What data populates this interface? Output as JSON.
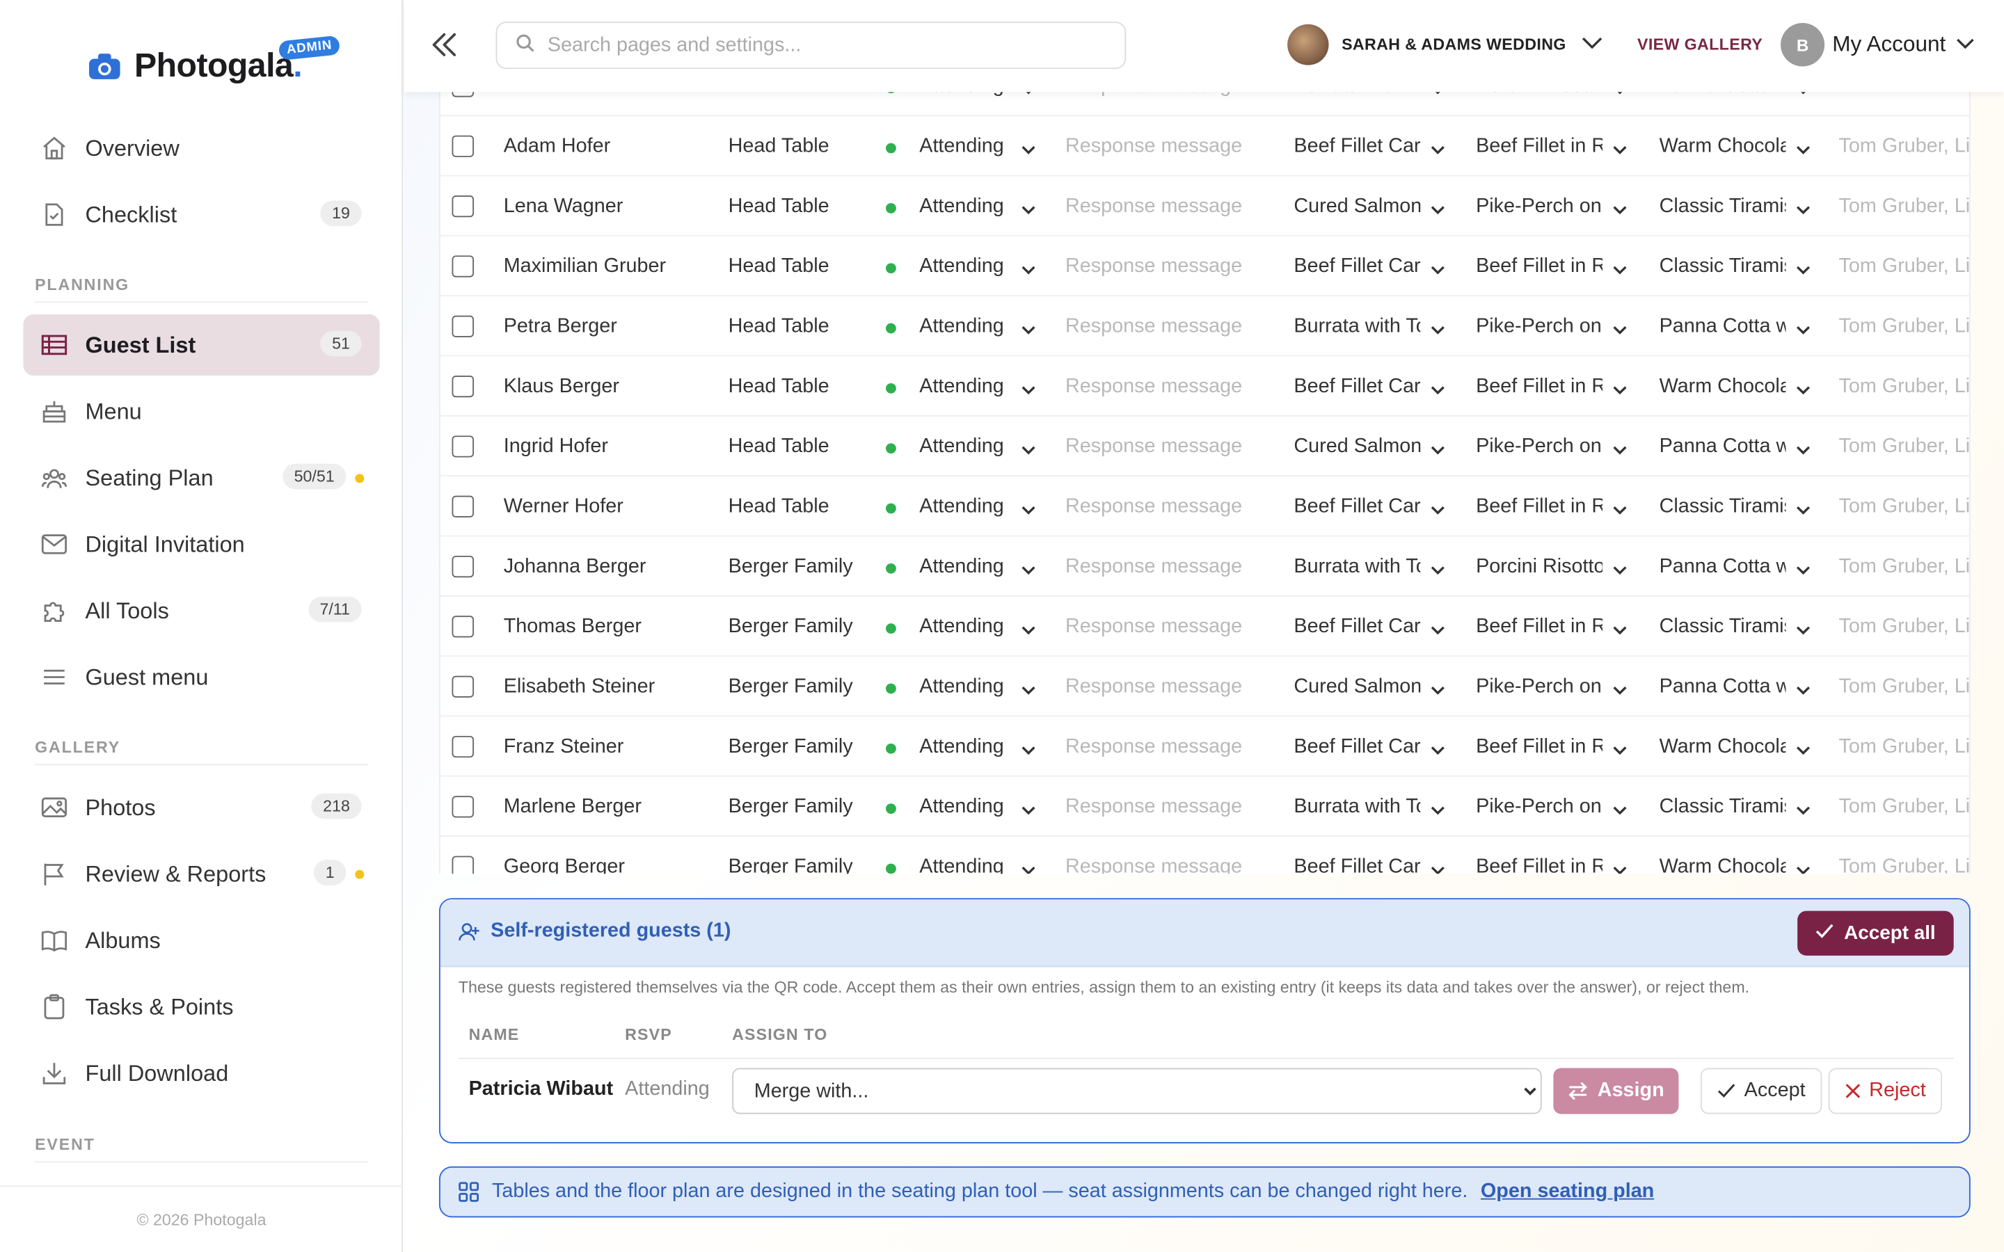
{
  "app": {
    "name_main": "Photogala",
    "name_dot": ".",
    "admin_badge": "ADMIN"
  },
  "sidebar": {
    "items": [
      {
        "label": "Overview",
        "icon": "home-icon"
      },
      {
        "label": "Checklist",
        "icon": "checklist-icon",
        "badge": "19"
      },
      {
        "label": "Guest List",
        "icon": "table-icon",
        "badge": "51",
        "active": true
      },
      {
        "label": "Menu",
        "icon": "cake-icon"
      },
      {
        "label": "Seating Plan",
        "icon": "people-icon",
        "badge": "50/51",
        "dot": true
      },
      {
        "label": "Digital Invitation",
        "icon": "envelope-icon"
      },
      {
        "label": "All Tools",
        "icon": "puzzle-icon",
        "badge": "7/11"
      },
      {
        "label": "Guest menu",
        "icon": "hamburger-icon"
      },
      {
        "label": "Photos",
        "icon": "image-icon",
        "badge": "218"
      },
      {
        "label": "Review & Reports",
        "icon": "flag-icon",
        "badge": "1",
        "dot": true
      },
      {
        "label": "Albums",
        "icon": "book-icon"
      },
      {
        "label": "Tasks & Points",
        "icon": "clipboard-icon"
      },
      {
        "label": "Full Download",
        "icon": "download-icon"
      }
    ],
    "sections": {
      "planning": "PLANNING",
      "gallery": "GALLERY",
      "event": "EVENT"
    },
    "footer": "© 2026 Photogala"
  },
  "header": {
    "search_placeholder": "Search pages and settings...",
    "event_name": "SARAH & ADAMS WEDDING",
    "view_gallery": "VIEW GALLERY",
    "account_initial": "B",
    "account_label": "My Account"
  },
  "guests": {
    "partial_row": {
      "rsvp": "Attending",
      "message": "Response message",
      "m1": "Burrata with T",
      "m2": "Porcini Risott",
      "m3": "Panna Cotta w"
    },
    "rows": [
      {
        "name": "Adam Hofer",
        "table": "Head Table",
        "rsvp": "Attending",
        "message": "Response message",
        "m1": "Beef Fillet Carpaccio",
        "m2": "Beef Fillet in Red Wine",
        "m3": "Warm Chocolate",
        "tags": "Tom Gruber, Lisa"
      },
      {
        "name": "Lena Wagner",
        "table": "Head Table",
        "rsvp": "Attending",
        "message": "Response message",
        "m1": "Cured Salmon",
        "m2": "Pike-Perch on",
        "m3": "Classic Tiramisu",
        "tags": "Tom Gruber, Lisa"
      },
      {
        "name": "Maximilian Gruber",
        "table": "Head Table",
        "rsvp": "Attending",
        "message": "Response message",
        "m1": "Beef Fillet Carpaccio",
        "m2": "Beef Fillet in Red Wine",
        "m3": "Classic Tiramisu",
        "tags": "Tom Gruber, Lisa"
      },
      {
        "name": "Petra Berger",
        "table": "Head Table",
        "rsvp": "Attending",
        "message": "Response message",
        "m1": "Burrata with Tomatoes",
        "m2": "Pike-Perch on",
        "m3": "Panna Cotta with",
        "tags": "Tom Gruber, Lisa"
      },
      {
        "name": "Klaus Berger",
        "table": "Head Table",
        "rsvp": "Attending",
        "message": "Response message",
        "m1": "Beef Fillet Carpaccio",
        "m2": "Beef Fillet in Red Wine",
        "m3": "Warm Chocolate",
        "tags": "Tom Gruber, Lisa"
      },
      {
        "name": "Ingrid Hofer",
        "table": "Head Table",
        "rsvp": "Attending",
        "message": "Response message",
        "m1": "Cured Salmon",
        "m2": "Pike-Perch on",
        "m3": "Panna Cotta with",
        "tags": "Tom Gruber, Lisa"
      },
      {
        "name": "Werner Hofer",
        "table": "Head Table",
        "rsvp": "Attending",
        "message": "Response message",
        "m1": "Beef Fillet Carpaccio",
        "m2": "Beef Fillet in Red Wine",
        "m3": "Classic Tiramisu",
        "tags": "Tom Gruber, Lisa"
      },
      {
        "name": "Johanna Berger",
        "table": "Berger Family",
        "rsvp": "Attending",
        "message": "Response message",
        "m1": "Burrata with Tomatoes",
        "m2": "Porcini Risotto",
        "m3": "Panna Cotta with",
        "tags": "Tom Gruber, Lisa"
      },
      {
        "name": "Thomas Berger",
        "table": "Berger Family",
        "rsvp": "Attending",
        "message": "Response message",
        "m1": "Beef Fillet Carpaccio",
        "m2": "Beef Fillet in Red Wine",
        "m3": "Classic Tiramisu",
        "tags": "Tom Gruber, Lisa"
      },
      {
        "name": "Elisabeth Steiner",
        "table": "Berger Family",
        "rsvp": "Attending",
        "message": "Response message",
        "m1": "Cured Salmon",
        "m2": "Pike-Perch on",
        "m3": "Panna Cotta with",
        "tags": "Tom Gruber, Lisa"
      },
      {
        "name": "Franz Steiner",
        "table": "Berger Family",
        "rsvp": "Attending",
        "message": "Response message",
        "m1": "Beef Fillet Carpaccio",
        "m2": "Beef Fillet in Red Wine",
        "m3": "Warm Chocolate",
        "tags": "Tom Gruber, Lisa"
      },
      {
        "name": "Marlene Berger",
        "table": "Berger Family",
        "rsvp": "Attending",
        "message": "Response message",
        "m1": "Burrata with Tomatoes",
        "m2": "Pike-Perch on",
        "m3": "Classic Tiramisu",
        "tags": "Tom Gruber, Lisa"
      },
      {
        "name": "Georg Berger",
        "table": "Berger Family",
        "rsvp": "Attending",
        "message": "Response message",
        "m1": "Beef Fillet Carpaccio",
        "m2": "Beef Fillet in Red Wine",
        "m3": "Warm Chocolate",
        "tags": "Tom Gruber, Lisa"
      }
    ]
  },
  "self_registered": {
    "title": "Self-registered guests (1)",
    "accept_all": "Accept all",
    "description": "These guests registered themselves via the QR code. Accept them as their own entries, assign them to an existing entry (it keeps its data and takes over the answer), or reject them.",
    "col_name": "NAME",
    "col_rsvp": "RSVP",
    "col_assign": "ASSIGN TO",
    "guest": {
      "name": "Patricia Wibaut",
      "rsvp": "Attending"
    },
    "merge_placeholder": "Merge with...",
    "assign": "Assign",
    "accept": "Accept",
    "reject": "Reject"
  },
  "info": {
    "text": "Tables and the floor plan are designed in the seating plan tool — seat assignments can be changed right here.",
    "link": "Open seating plan"
  },
  "colors": {
    "accent": "#7a2246",
    "active_bg": "#e9dde2",
    "info_blue": "#2f68d6",
    "attending_green": "#2fb04f",
    "badge_dot": "#f2c21b"
  }
}
